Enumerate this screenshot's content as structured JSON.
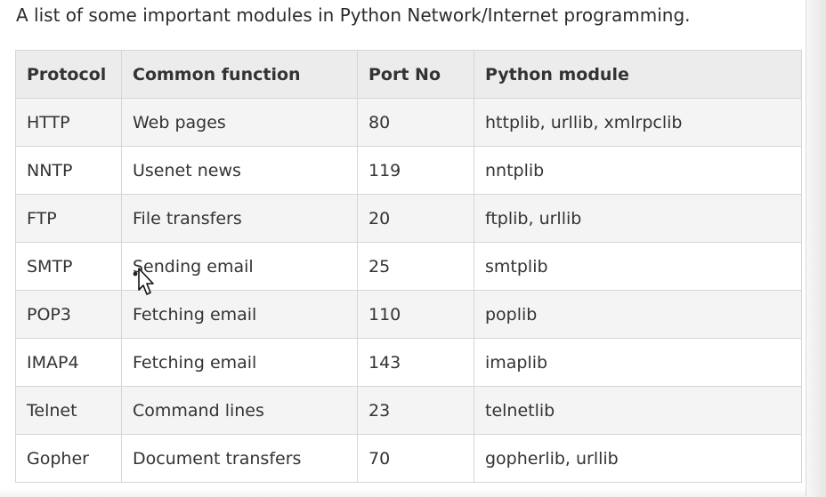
{
  "intro": "A list of some important modules in Python Network/Internet programming.",
  "table": {
    "headers": [
      "Protocol",
      "Common function",
      "Port No",
      "Python module"
    ],
    "rows": [
      [
        "HTTP",
        "Web pages",
        "80",
        "httplib, urllib, xmlrpclib"
      ],
      [
        "NNTP",
        "Usenet news",
        "119",
        "nntplib"
      ],
      [
        "FTP",
        "File transfers",
        "20",
        "ftplib, urllib"
      ],
      [
        "SMTP",
        "Sending email",
        "25",
        "smtplib"
      ],
      [
        "POP3",
        "Fetching email",
        "110",
        "poplib"
      ],
      [
        "IMAP4",
        "Fetching email",
        "143",
        "imaplib"
      ],
      [
        "Telnet",
        "Command lines",
        "23",
        "telnetlib"
      ],
      [
        "Gopher",
        "Document transfers",
        "70",
        "gopherlib, urllib"
      ]
    ]
  },
  "cursor_icon": "arrow-pointer-icon"
}
